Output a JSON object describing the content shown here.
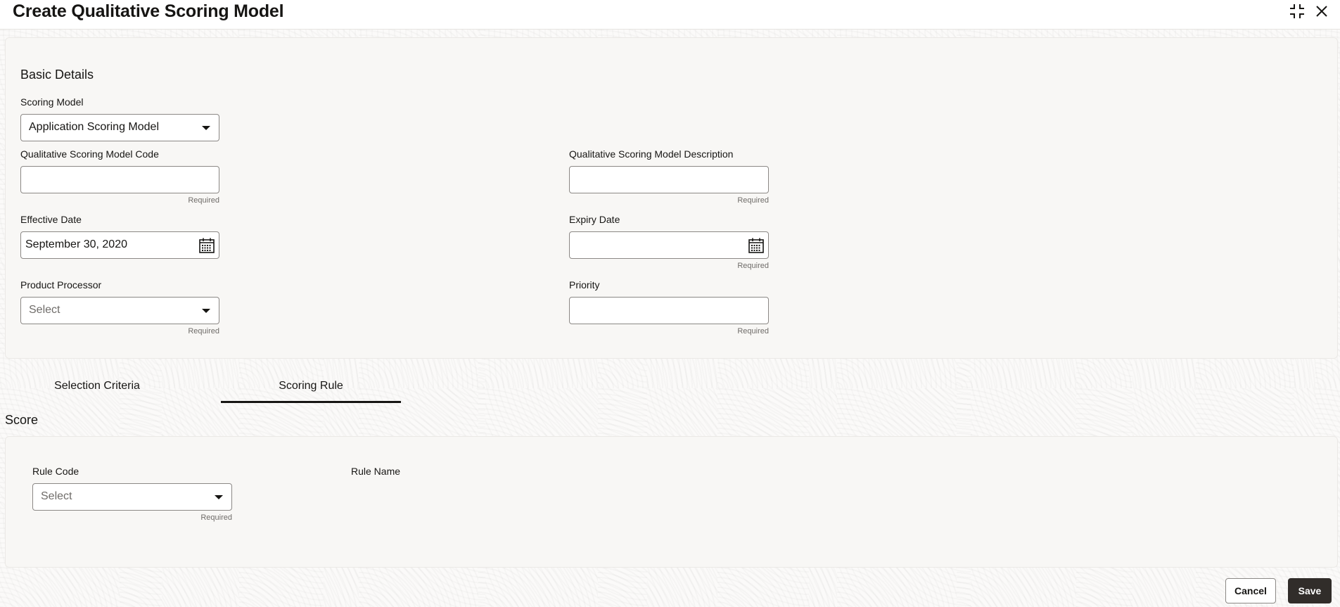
{
  "header": {
    "title": "Create Qualitative Scoring Model",
    "icons": [
      "collapse-icon",
      "close-icon"
    ]
  },
  "basic_details": {
    "section_title": "Basic Details",
    "scoring_model": {
      "label": "Scoring Model",
      "value": "Application Scoring Model"
    },
    "model_code": {
      "label": "Qualitative Scoring Model Code",
      "value": "",
      "helper": "Required"
    },
    "model_description": {
      "label": "Qualitative Scoring Model Description",
      "value": "",
      "helper": "Required"
    },
    "effective_date": {
      "label": "Effective Date",
      "value": "September 30, 2020"
    },
    "expiry_date": {
      "label": "Expiry Date",
      "value": "",
      "helper": "Required"
    },
    "product_processor": {
      "label": "Product Processor",
      "placeholder": "Select",
      "helper": "Required"
    },
    "priority": {
      "label": "Priority",
      "value": "",
      "helper": "Required"
    }
  },
  "tabs": [
    {
      "label": "Selection Criteria",
      "active": false
    },
    {
      "label": "Scoring Rule",
      "active": true
    }
  ],
  "score": {
    "section_title": "Score",
    "rule_code": {
      "label": "Rule Code",
      "placeholder": "Select",
      "helper": "Required"
    },
    "rule_name": {
      "label": "Rule Name"
    }
  },
  "footer": {
    "cancel_label": "Cancel",
    "save_label": "Save"
  }
}
